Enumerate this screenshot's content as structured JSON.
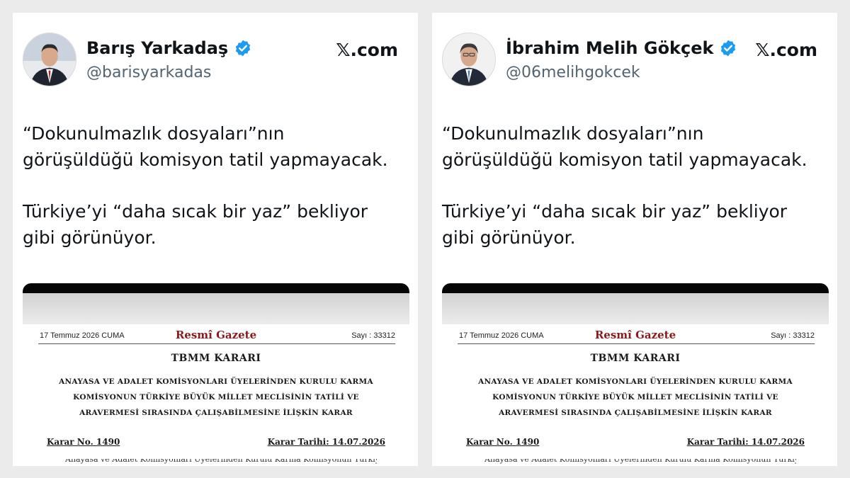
{
  "left_tweet": {
    "author_name": "Barış Yarkadaş",
    "handle": "@barisyarkadas",
    "source": "𝕏.com",
    "verified_icon": "verified-badge-icon",
    "text_line_1": "“Dokunulmazlık dosyaları”nın",
    "text_line_2": "görüşüldüğü komisyon tatil yapmayacak.",
    "text_line_3": "Türkiye’yi “daha sıcak bir yaz” bekliyor",
    "text_line_4": "gibi görünüyor."
  },
  "right_tweet": {
    "author_name": "İbrahim Melih Gökçek",
    "handle": "@06melihgokcek",
    "source": "𝕏.com",
    "verified_icon": "verified-badge-icon",
    "text_line_1": "“Dokunulmazlık dosyaları”nın",
    "text_line_2": "görüşüldüğü komisyon tatil yapmayacak.",
    "text_line_3": "Türkiye’yi “daha sıcak bir yaz” bekliyor",
    "text_line_4": "gibi görünüyor."
  },
  "gazette": {
    "date": "17 Temmuz 2026 CUMA",
    "title": "Resmî Gazete",
    "issue": "Sayı : 33312",
    "decision_heading": "TBMM KARARI",
    "subject_line_1": "ANAYASA VE ADALET KOMİSYONLARI ÜYELERİNDEN KURULU KARMA",
    "subject_line_2": "KOMİSYONUN TÜRKİYE BÜYÜK MİLLET MECLİSİNİN TATİLİ VE",
    "subject_line_3": "ARAVERMESİ SIRASINDA ÇALIŞABİLMESİNE İLİŞKİN KARAR",
    "decision_no": "Karar No. 1490",
    "decision_date": "Karar Tarihi: 14.07.2026",
    "body_cut": "Anayasa ve Adalet Komisyonları Üyelerinden Kurulu Karma Komisyonun Türkiye"
  },
  "colors": {
    "verified": "#1d9bf0",
    "gazette_title": "#8b1a1a",
    "text": "#0f1419",
    "muted": "#536471"
  }
}
